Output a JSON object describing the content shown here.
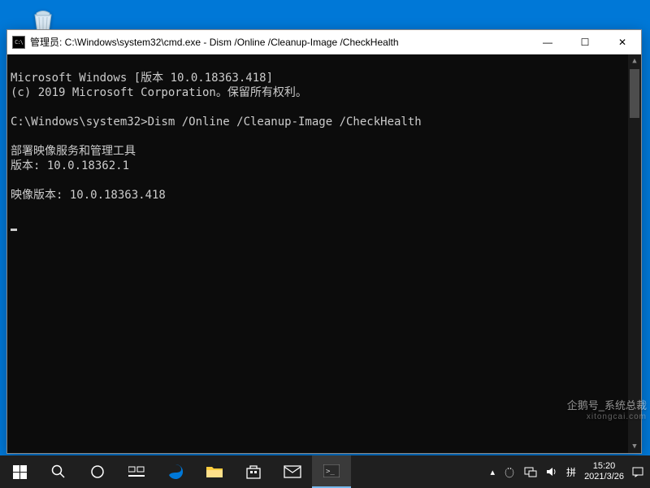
{
  "desktop": {
    "recycle_bin_label": "回收站"
  },
  "window": {
    "icon_text": "C:\\",
    "title": "管理员: C:\\Windows\\system32\\cmd.exe - Dism  /Online /Cleanup-Image /CheckHealth",
    "minimize": "—",
    "maximize": "☐",
    "close": "✕"
  },
  "terminal": {
    "lines": [
      "Microsoft Windows [版本 10.0.18363.418]",
      "(c) 2019 Microsoft Corporation。保留所有权利。",
      "",
      "C:\\Windows\\system32>Dism /Online /Cleanup-Image /CheckHealth",
      "",
      "部署映像服务和管理工具",
      "版本: 10.0.18362.1",
      "",
      "映像版本: 10.0.18363.418",
      ""
    ]
  },
  "taskbar": {
    "start": "start-icon",
    "search": "search-icon",
    "cortana": "cortana-icon",
    "taskview": "task-view-icon",
    "edge": "edge-icon",
    "explorer": "file-explorer-icon",
    "store": "store-icon",
    "mail": "mail-icon",
    "cmd": "cmd-icon"
  },
  "systray": {
    "chevron": "▴",
    "ime": "拼",
    "network": "network-icon",
    "volume": "volume-icon",
    "time": "15:20",
    "date": "2021/3/26"
  },
  "watermark": {
    "line1": "企鹅号_系统总裁",
    "line2": "xitongcai.com"
  }
}
